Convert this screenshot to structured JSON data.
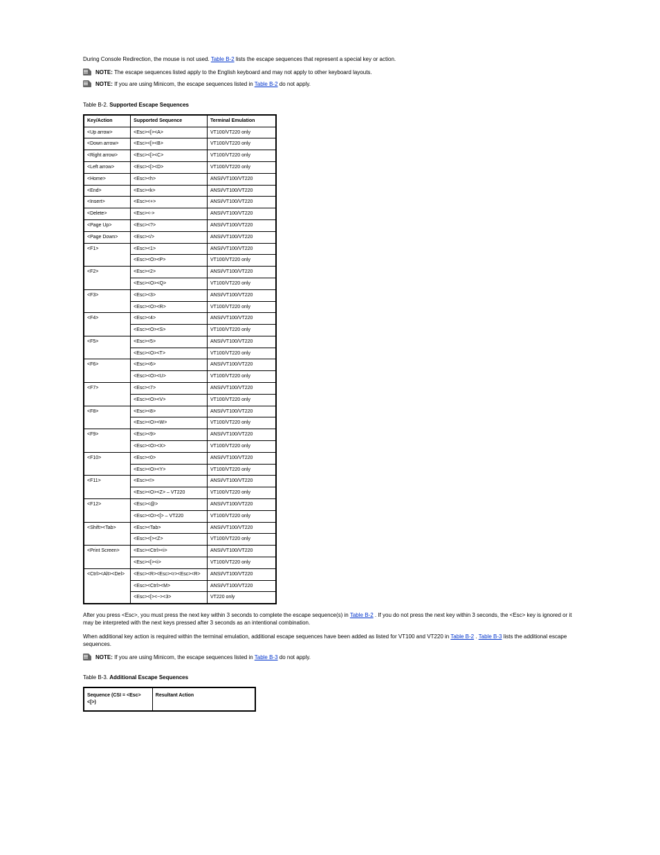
{
  "p1_a": "During Console Redirection, the mouse is not used. ",
  "p1_link": "Table B-2",
  "p1_b": " lists the escape sequences that represent a special key or action.",
  "note1_label": "NOTE:",
  "note1_text": " The escape sequences listed apply to the English keyboard and may not apply to other keyboard layouts.",
  "note2_label": "NOTE:",
  "note2_a": " If you are using Minicom, the escape sequences listed in ",
  "note2_link": "Table B-2",
  "note2_b": " do not apply.",
  "table1_caption_prefix": "Table B-2.",
  "table1_caption_title": "Supported Escape Sequences",
  "table1_headers": [
    "Key/Action",
    "Supported Sequence",
    "Terminal Emulation"
  ],
  "table1_rows": [
    {
      "k": "<Up arrow>",
      "s": [
        "<Esc><[><A>"
      ],
      "t": [
        "VT100/VT220 only"
      ]
    },
    {
      "k": "<Down arrow>",
      "s": [
        "<Esc><[><B>"
      ],
      "t": [
        "VT100/VT220 only"
      ]
    },
    {
      "k": "<Right arrow>",
      "s": [
        "<Esc><[><C>"
      ],
      "t": [
        "VT100/VT220 only"
      ]
    },
    {
      "k": "<Left arrow>",
      "s": [
        "<Esc><[><D>"
      ],
      "t": [
        "VT100/VT220 only"
      ]
    },
    {
      "k": "<Home>",
      "s": [
        "<Esc><h>"
      ],
      "t": [
        "ANSI/VT100/VT220"
      ]
    },
    {
      "k": "<End>",
      "s": [
        "<Esc><k>"
      ],
      "t": [
        "ANSI/VT100/VT220"
      ]
    },
    {
      "k": "<Insert>",
      "s": [
        "<Esc><+>"
      ],
      "t": [
        "ANSI/VT100/VT220"
      ]
    },
    {
      "k": "<Delete>",
      "s": [
        "<Esc><->"
      ],
      "t": [
        "ANSI/VT100/VT220"
      ]
    },
    {
      "k": "<Page Up>",
      "s": [
        "<Esc><?>"
      ],
      "t": [
        "ANSI/VT100/VT220"
      ]
    },
    {
      "k": "<Page Down>",
      "s": [
        "<Esc></>"
      ],
      "t": [
        "ANSI/VT100/VT220"
      ]
    },
    {
      "k": "<F1>",
      "s": [
        "<Esc><1>",
        "<Esc><O><P>"
      ],
      "t": [
        "ANSI/VT100/VT220",
        "VT100/VT220 only"
      ]
    },
    {
      "k": "<F2>",
      "s": [
        "<Esc><2>",
        "<Esc><O><Q>"
      ],
      "t": [
        "ANSI/VT100/VT220",
        "VT100/VT220 only"
      ]
    },
    {
      "k": "<F3>",
      "s": [
        "<Esc><3>",
        "<Esc><O><R>"
      ],
      "t": [
        "ANSI/VT100/VT220",
        "VT100/VT220 only"
      ]
    },
    {
      "k": "<F4>",
      "s": [
        "<Esc><4>",
        "<Esc><O><S>"
      ],
      "t": [
        "ANSI/VT100/VT220",
        "VT100/VT220 only"
      ]
    },
    {
      "k": "<F5>",
      "s": [
        "<Esc><5>",
        "<Esc><O><T>"
      ],
      "t": [
        "ANSI/VT100/VT220",
        "VT100/VT220 only"
      ]
    },
    {
      "k": "<F6>",
      "s": [
        "<Esc><6>",
        "<Esc><O><U>"
      ],
      "t": [
        "ANSI/VT100/VT220",
        "VT100/VT220 only"
      ]
    },
    {
      "k": "<F7>",
      "s": [
        "<Esc><7>",
        "<Esc><O><V>"
      ],
      "t": [
        "ANSI/VT100/VT220",
        "VT100/VT220 only"
      ]
    },
    {
      "k": "<F8>",
      "s": [
        "<Esc><8>",
        "<Esc><O><W>"
      ],
      "t": [
        "ANSI/VT100/VT220",
        "VT100/VT220 only"
      ]
    },
    {
      "k": "<F9>",
      "s": [
        "<Esc><9>",
        "<Esc><O><X>"
      ],
      "t": [
        "ANSI/VT100/VT220",
        "VT100/VT220 only"
      ]
    },
    {
      "k": "<F10>",
      "s": [
        "<Esc><0>",
        "<Esc><O><Y>"
      ],
      "t": [
        "ANSI/VT100/VT220",
        "VT100/VT220 only"
      ]
    },
    {
      "k": "<F11>",
      "s": [
        "<Esc><!>",
        "<Esc><O><Z> – VT220"
      ],
      "t": [
        "ANSI/VT100/VT220",
        "VT100/VT220 only"
      ]
    },
    {
      "k": "<F12>",
      "s": [
        "<Esc><@>",
        "<Esc><O><[> – VT220"
      ],
      "t": [
        "ANSI/VT100/VT220",
        "VT100/VT220 only"
      ]
    },
    {
      "k": "<Shift><Tab>",
      "s": [
        "<Esc><Tab>",
        "<Esc><[><Z>"
      ],
      "t": [
        "ANSI/VT100/VT220",
        "VT100/VT220 only"
      ]
    },
    {
      "k": "<Print Screen>",
      "s": [
        "<Esc><Ctrl><i>",
        "<Esc><[><i>"
      ],
      "t": [
        "ANSI/VT100/VT220",
        "VT100/VT220 only"
      ]
    },
    {
      "k": "<Ctrl><Alt><Del>",
      "s": [
        "<Esc><R><Esc><r><Esc><R>",
        "<Esc><Ctrl><M>",
        "<Esc><[><~><3>"
      ],
      "t": [
        "ANSI/VT100/VT220",
        "ANSI/VT100/VT220",
        "VT220 only"
      ]
    }
  ],
  "p2_a": "After you press <Esc>, you must press the next key within 3 seconds to complete the escape sequence(s) in ",
  "p2_link": "Table B-2",
  "p2_b": ". If you do not press the next key within 3 seconds, the <Esc> key is ignored or it may be interpreted with the next keys pressed after 3 seconds as an intentional combination.",
  "p3_a": "When additional key action is required within the terminal emulation, additional escape sequences have been added as listed for VT100 and VT220 in ",
  "p3_link_a": "Table B-2",
  "p3_mid": ". ",
  "p3_link_b": "Table B-3",
  "p3_c": " lists the additional escape sequences.",
  "note3_label": "NOTE:",
  "note3_a": " If you are using Minicom, the escape sequences listed in ",
  "note3_link": "Table B-3",
  "note3_b": " do not apply.",
  "table2_caption_prefix": "Table B-3.",
  "table2_caption_title": "Additional Escape Sequences",
  "table2_headers": [
    "Sequence (CSI = <Esc><[>)",
    "Resultant Action"
  ]
}
